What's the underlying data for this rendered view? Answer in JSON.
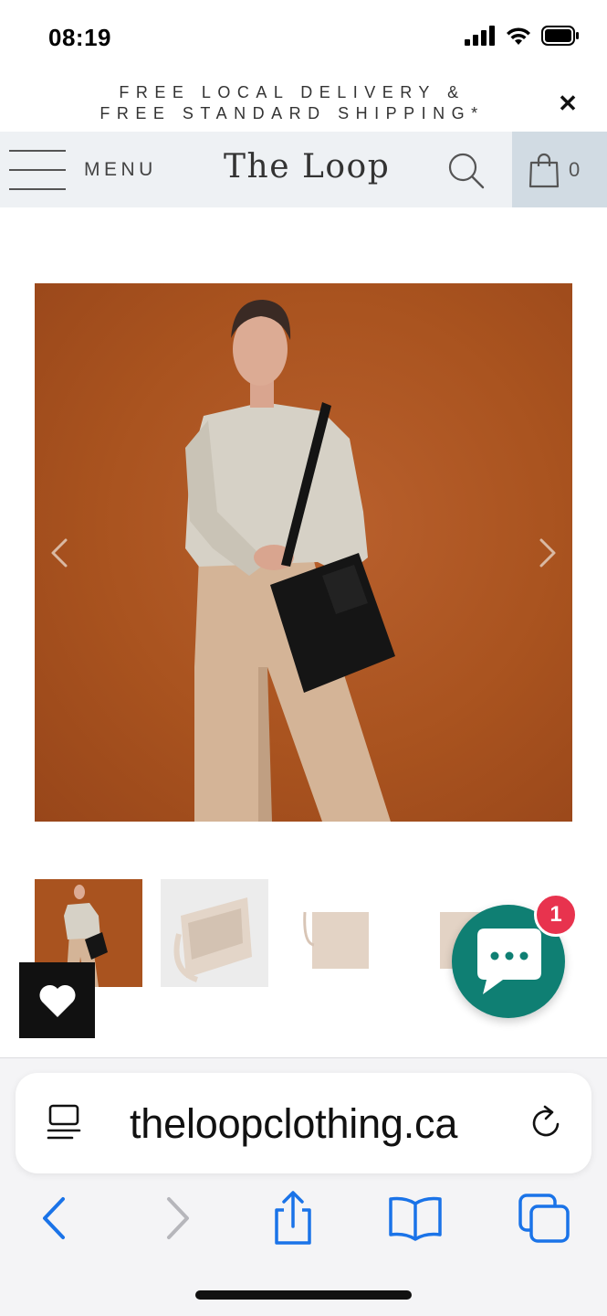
{
  "status_bar": {
    "time": "08:19"
  },
  "announcement": {
    "line1": "FREE LOCAL DELIVERY &",
    "line2": "FREE STANDARD SHIPPING*",
    "close_glyph": "✕"
  },
  "header": {
    "menu_label": "MENU",
    "logo": "The Loop",
    "cart_count": "0"
  },
  "product": {
    "image_icon": "product-photo",
    "prev_icon": "chevron-left-icon",
    "next_icon": "chevron-right-icon",
    "thumbnail_count": 4,
    "selected_thumbnail": 1
  },
  "chat": {
    "badge_count": "1"
  },
  "browser": {
    "url": "theloopclothing.ca"
  },
  "colors": {
    "header_bg": "#eef1f4",
    "cart_bg": "#d1dbe3",
    "chat_bg": "#0f7f73",
    "badge_bg": "#e8334e",
    "ios_blue": "#1a73e8",
    "image_bg": "#a9531f"
  }
}
